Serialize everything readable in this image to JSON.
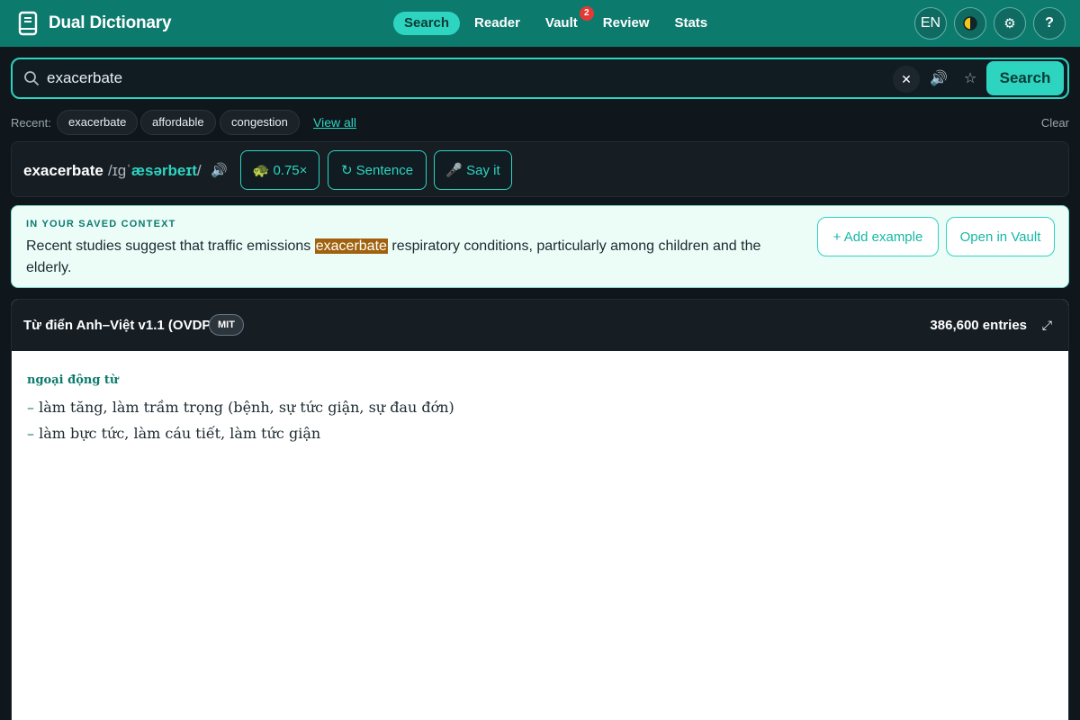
{
  "app": {
    "title": "Dual Dictionary",
    "nav": [
      {
        "label": "Search",
        "active": true
      },
      {
        "label": "Reader"
      },
      {
        "label": "Vault",
        "badge": "2"
      },
      {
        "label": "Review"
      },
      {
        "label": "Stats"
      }
    ],
    "lang_button": "EN",
    "theme_icon": "half-moon-icon",
    "settings_icon": "gear-icon",
    "help_button": "?"
  },
  "search": {
    "value": "exacerbate",
    "placeholder": "",
    "clear_label": "✕",
    "search_label": "Search"
  },
  "recent": {
    "label": "Recent:",
    "items": [
      "exacerbate",
      "affordable",
      "congestion"
    ],
    "view_all": "View all",
    "clear": "Clear"
  },
  "word": {
    "headword": "exacerbate",
    "ipa_pre": "/ɪɡˈ",
    "ipa_stress": "æsərbeɪt",
    "ipa_post": "/",
    "speed_label": "🐢 0.75×",
    "sentence_label": "↻ Sentence",
    "sayit_label": "🎤 Say it"
  },
  "context": {
    "label": "IN YOUR SAVED CONTEXT",
    "before": "Recent studies suggest that traffic emissions ",
    "highlight": "exacerbate",
    "after": " respiratory conditions, particularly among children and the elderly.",
    "add_example": "+ Add example",
    "open_vault": "Open in Vault"
  },
  "dictionary": {
    "title": "Từ điển Anh–Việt v1.1 (OVDP)",
    "license": "MIT",
    "entries": "386,600 entries",
    "expand_icon": "⤢",
    "pos": "ngoại động từ",
    "senses": [
      "làm tăng, làm trầm trọng (bệnh, sự tức giận, sự đau đớn)",
      "làm bực tức, làm cáu tiết, làm tức giận"
    ],
    "dash": "–"
  },
  "colors": {
    "topbar": "#0d7a6e",
    "accent": "#2dd4bf",
    "background": "#0f171d",
    "highlight": "#a0620e",
    "badge": "#e53935"
  }
}
